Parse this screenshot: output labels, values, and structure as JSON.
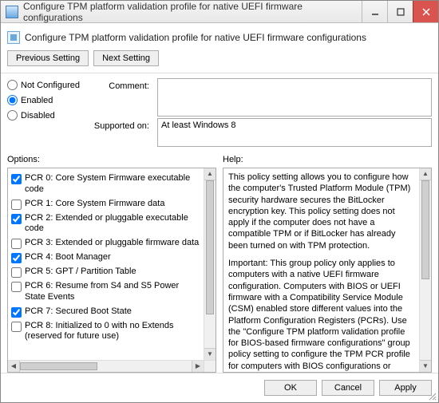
{
  "window": {
    "title": "Configure TPM platform validation profile for native UEFI firmware configurations"
  },
  "heading": "Configure TPM platform validation profile for native UEFI firmware configurations",
  "nav": {
    "prev": "Previous Setting",
    "next": "Next Setting"
  },
  "state": {
    "not_configured": "Not Configured",
    "enabled": "Enabled",
    "disabled": "Disabled",
    "selected": "enabled"
  },
  "labels": {
    "comment": "Comment:",
    "supported_on": "Supported on:",
    "options": "Options:",
    "help": "Help:"
  },
  "comment_value": "",
  "supported_on_value": "At least Windows 8",
  "options_items": [
    {
      "checked": true,
      "label": "PCR 0: Core System Firmware executable code"
    },
    {
      "checked": false,
      "label": "PCR 1: Core System Firmware data"
    },
    {
      "checked": true,
      "label": "PCR 2: Extended or pluggable executable code"
    },
    {
      "checked": false,
      "label": "PCR 3: Extended or pluggable firmware data"
    },
    {
      "checked": true,
      "label": "PCR 4: Boot Manager"
    },
    {
      "checked": false,
      "label": "PCR 5: GPT / Partition Table"
    },
    {
      "checked": false,
      "label": "PCR 6: Resume from S4 and S5 Power State Events"
    },
    {
      "checked": true,
      "label": "PCR 7: Secured Boot State"
    },
    {
      "checked": false,
      "label": "PCR 8: Initialized to 0 with no Extends (reserved for future use)"
    }
  ],
  "help_text": "This policy setting allows you to configure how the computer's Trusted Platform Module (TPM) security hardware secures the BitLocker encryption key. This policy setting does not apply if the computer does not have a compatible TPM or if BitLocker has already been turned on with TPM protection.\n\nImportant: This group policy only applies to computers with a native UEFI firmware configuration. Computers with BIOS or UEFI firmware with a Compatibility Service Module (CSM) enabled store different values into the Platform Configuration Registers (PCRs). Use the \"Configure TPM platform validation profile for BIOS-based firmware configurations\" group policy setting to configure the TPM PCR profile for computers with BIOS configurations or computers with UEFI firmware with a CSM enabled.",
  "buttons": {
    "ok": "OK",
    "cancel": "Cancel",
    "apply": "Apply"
  }
}
